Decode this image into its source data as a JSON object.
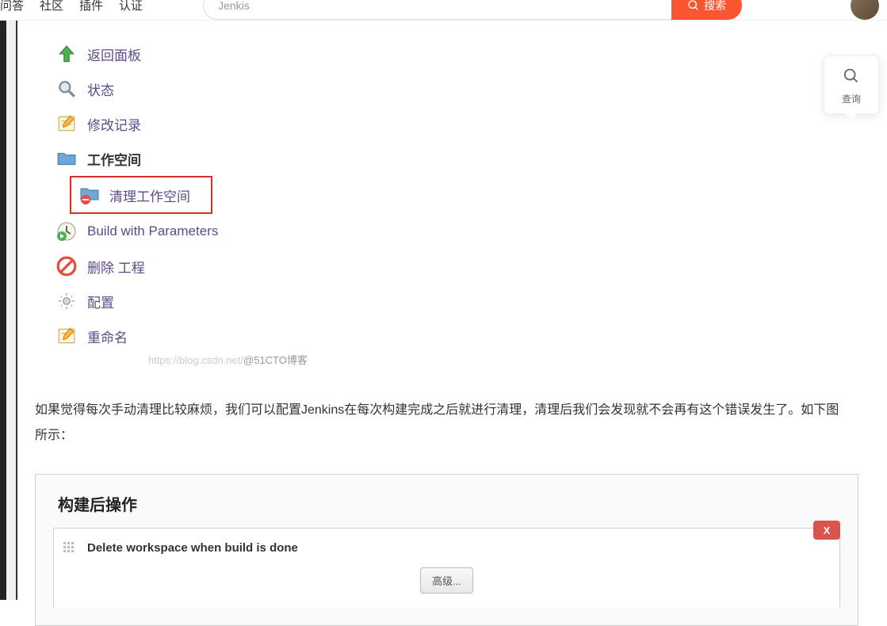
{
  "nav": {
    "items": [
      "问答",
      "社区",
      "插件",
      "认证"
    ]
  },
  "search": {
    "value": "Jenkis",
    "button": "搜索"
  },
  "floating": {
    "label": "查询"
  },
  "menu": {
    "back": "返回面板",
    "status": "状态",
    "history": "修改记录",
    "workspace": "工作空间",
    "clear_workspace": "清理工作空间",
    "build_params": "Build with Parameters",
    "delete": "删除 工程",
    "config": "配置",
    "rename": "重命名"
  },
  "watermark": {
    "prefix": "https://blog.csdn.net/",
    "suffix": "@51CTO博客"
  },
  "article": {
    "text": "如果觉得每次手动清理比较麻烦，我们可以配置Jenkins在每次构建完成之后就进行清理，清理后我们会发现就不会再有这个错误发生了。如下图所示："
  },
  "panel": {
    "title": "构建后操作",
    "item_label": "Delete workspace when build is done",
    "advanced": "高级...",
    "close": "X"
  }
}
